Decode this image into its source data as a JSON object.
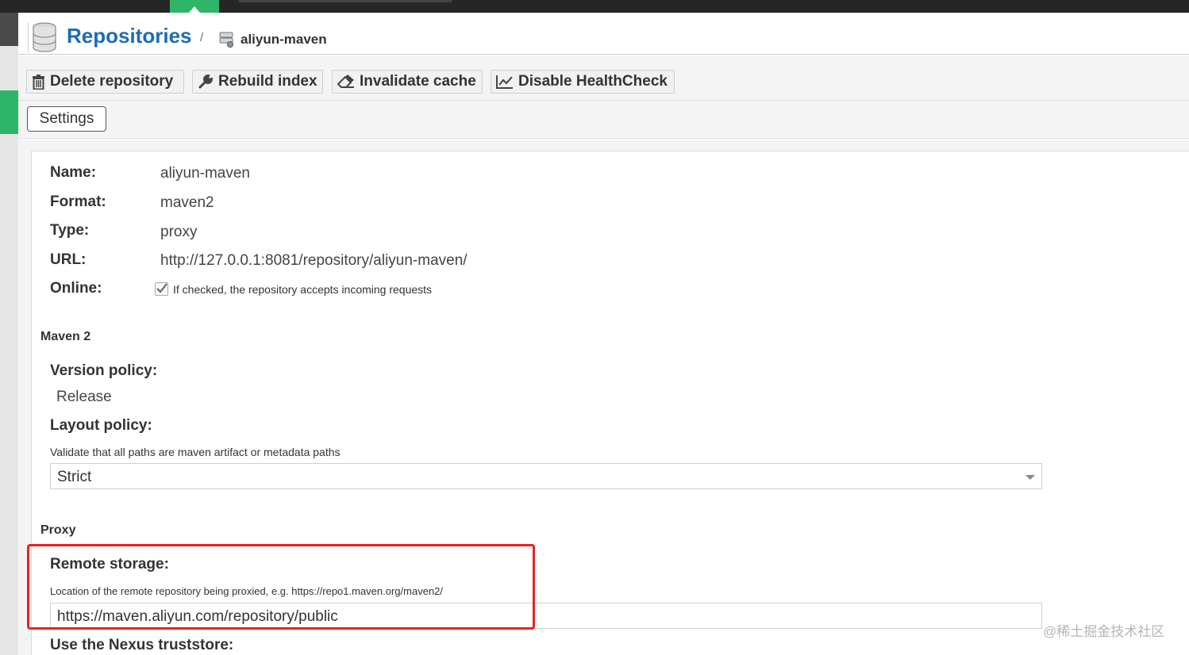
{
  "header": {
    "title": "Repositories",
    "separator": "/",
    "repo_name": "aliyun-maven"
  },
  "toolbar": {
    "delete_label": "Delete repository",
    "rebuild_label": "Rebuild index",
    "invalidate_label": "Invalidate cache",
    "healthcheck_label": "Disable HealthCheck"
  },
  "tabs": {
    "settings_label": "Settings"
  },
  "summary": {
    "name_label": "Name:",
    "name_value": "aliyun-maven",
    "format_label": "Format:",
    "format_value": "maven2",
    "type_label": "Type:",
    "type_value": "proxy",
    "url_label": "URL:",
    "url_value": "http://127.0.0.1:8081/repository/aliyun-maven/",
    "online_label": "Online:",
    "online_checked": true,
    "online_hint": "If checked, the repository accepts incoming requests"
  },
  "maven": {
    "section_title": "Maven 2",
    "version_policy_label": "Version policy:",
    "version_policy_value": "Release",
    "layout_policy_label": "Layout policy:",
    "layout_policy_hint": "Validate that all paths are maven artifact or metadata paths",
    "layout_policy_value": "Strict"
  },
  "proxy": {
    "section_title": "Proxy",
    "remote_storage_label": "Remote storage:",
    "remote_storage_hint": "Location of the remote repository being proxied, e.g. https://repo1.maven.org/maven2/",
    "remote_storage_value": "https://maven.aliyun.com/repository/public",
    "truststore_label": "Use the Nexus truststore:"
  },
  "watermark": "@稀土掘金技术社区",
  "colors": {
    "title_blue": "#1c6db3",
    "accent_green": "#2fb56a",
    "highlight_red": "#e8231f"
  },
  "icons": [
    "database-icon",
    "repository-icon",
    "trash-icon",
    "wrench-icon",
    "eraser-icon",
    "chart-line-icon",
    "checkmark-icon",
    "chevron-down-icon"
  ]
}
